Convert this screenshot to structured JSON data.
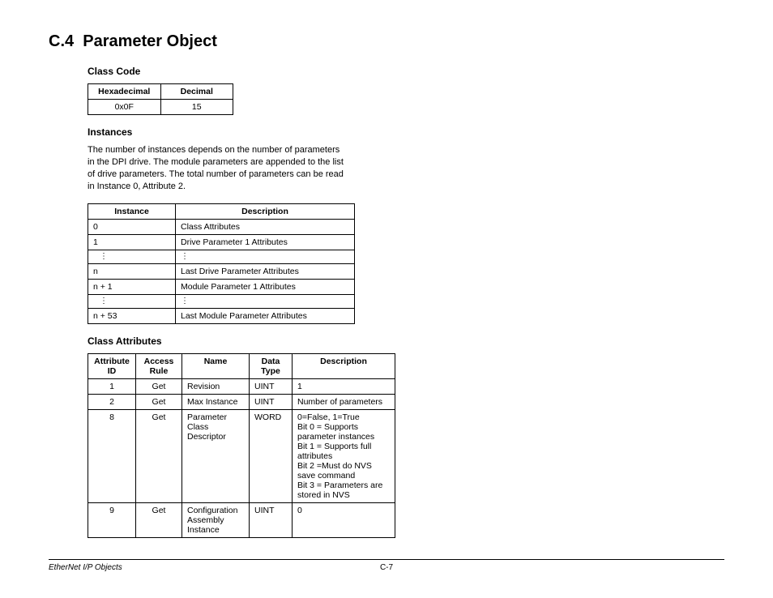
{
  "section": {
    "number": "C.4",
    "title": "Parameter Object"
  },
  "classcode": {
    "heading": "Class Code",
    "headers": [
      "Hexadecimal",
      "Decimal"
    ],
    "row": [
      "0x0F",
      "15"
    ]
  },
  "instances": {
    "heading": "Instances",
    "paragraph": "The number of instances depends on the number of parameters in the DPI drive. The module parameters are appended to the list of drive parameters. The total number of parameters can be read in Instance 0, Attribute 2.",
    "headers": [
      "Instance",
      "Description"
    ],
    "rows": [
      {
        "inst": "0",
        "desc": "Class Attributes"
      },
      {
        "inst": "1",
        "desc": "Drive Parameter 1 Attributes"
      },
      {
        "inst": "⋮",
        "desc": "⋮",
        "dots": true
      },
      {
        "inst": "n",
        "desc": "Last Drive Parameter Attributes"
      },
      {
        "inst": "n + 1",
        "desc": "Module Parameter 1 Attributes"
      },
      {
        "inst": "⋮",
        "desc": "⋮",
        "dots": true
      },
      {
        "inst": "n + 53",
        "desc": "Last Module Parameter Attributes"
      }
    ]
  },
  "classattrs": {
    "heading": "Class Attributes",
    "headers": [
      "Attribute ID",
      "Access Rule",
      "Name",
      "Data Type",
      "Description"
    ],
    "rows": [
      {
        "id": "1",
        "rule": "Get",
        "name": "Revision",
        "type": "UINT",
        "desc": [
          "1"
        ]
      },
      {
        "id": "2",
        "rule": "Get",
        "name": "Max Instance",
        "type": "UINT",
        "desc": [
          "Number of parameters"
        ]
      },
      {
        "id": "8",
        "rule": "Get",
        "name": "Parameter Class Descriptor",
        "type": "WORD",
        "desc": [
          "0=False, 1=True",
          "Bit 0 = Supports parameter instances",
          "Bit 1 = Supports full attributes",
          "Bit 2 =Must do NVS save command",
          "Bit 3 = Parameters are stored in NVS"
        ]
      },
      {
        "id": "9",
        "rule": "Get",
        "name": "Configuration Assembly Instance",
        "type": "UINT",
        "desc": [
          "0"
        ]
      }
    ]
  },
  "footer": {
    "left": "EtherNet I/P Objects",
    "page": "C-7"
  }
}
